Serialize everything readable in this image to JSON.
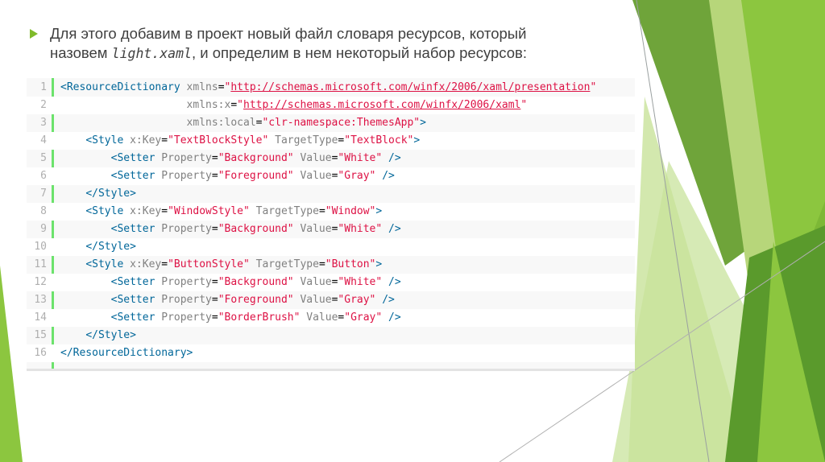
{
  "slide": {
    "bullet_line1": "Для этого добавим в проект новый файл словаря ресурсов, который",
    "bullet_line2_prefix": "назовем ",
    "bullet_filename": "light.xaml",
    "bullet_line2_suffix": ", и определим в нем некоторый набор ресурсов:"
  },
  "code": {
    "lines": [
      {
        "n": "1",
        "code": "<ResourceDictionary xmlns=\"http://schemas.microsoft.com/winfx/2006/xaml/presentation\""
      },
      {
        "n": "2",
        "code": "                    xmlns:x=\"http://schemas.microsoft.com/winfx/2006/xaml\""
      },
      {
        "n": "3",
        "code": "                    xmlns:local=\"clr-namespace:ThemesApp\">"
      },
      {
        "n": "4",
        "code": "    <Style x:Key=\"TextBlockStyle\" TargetType=\"TextBlock\">"
      },
      {
        "n": "5",
        "code": "        <Setter Property=\"Background\" Value=\"White\" />"
      },
      {
        "n": "6",
        "code": "        <Setter Property=\"Foreground\" Value=\"Gray\" />"
      },
      {
        "n": "7",
        "code": "    </Style>"
      },
      {
        "n": "8",
        "code": "    <Style x:Key=\"WindowStyle\" TargetType=\"Window\">"
      },
      {
        "n": "9",
        "code": "        <Setter Property=\"Background\" Value=\"White\" />"
      },
      {
        "n": "10",
        "code": "    </Style>"
      },
      {
        "n": "11",
        "code": "    <Style x:Key=\"ButtonStyle\" TargetType=\"Button\">"
      },
      {
        "n": "12",
        "code": "        <Setter Property=\"Background\" Value=\"White\" />"
      },
      {
        "n": "13",
        "code": "        <Setter Property=\"Foreground\" Value=\"Gray\" />"
      },
      {
        "n": "14",
        "code": "        <Setter Property=\"BorderBrush\" Value=\"Gray\" />"
      },
      {
        "n": "15",
        "code": "    </Style>"
      },
      {
        "n": "16",
        "code": "</ResourceDictionary>"
      }
    ]
  },
  "colors": {
    "bullet": "#7fba2b",
    "tag": "#006699",
    "attribute": "#808080",
    "value": "#dd1144",
    "gutter_border": "#6ce26c",
    "green_dark": "#5a9a2c",
    "green_mid": "#8cc63f",
    "green_light": "#c8e29a"
  },
  "icons": {
    "bullet": "triangle-right-bullet-icon"
  }
}
